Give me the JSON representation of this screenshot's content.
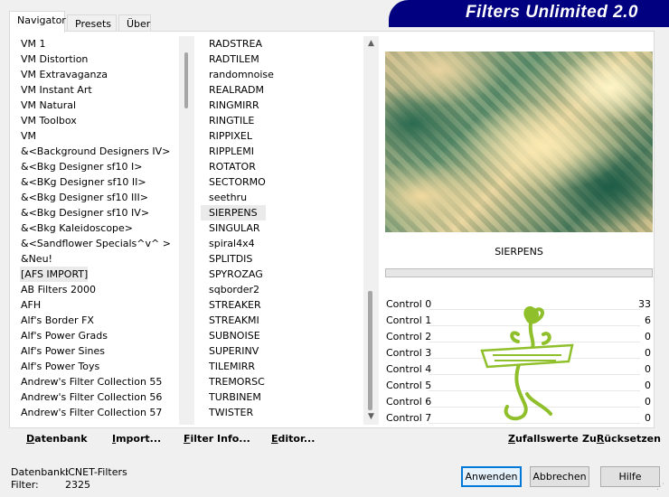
{
  "tabs": [
    {
      "label": "Navigator"
    },
    {
      "label": "Presets"
    },
    {
      "label": "Über"
    }
  ],
  "banner": {
    "title": "Filters Unlimited 2.0"
  },
  "categories": [
    "VM 1",
    "VM Distortion",
    "VM Extravaganza",
    "VM Instant Art",
    "VM Natural",
    "VM Toolbox",
    "VM",
    "&<Background Designers IV>",
    "&<Bkg Designer sf10 I>",
    "&<BKg Designer sf10 II>",
    "&<Bkg Designer sf10 III>",
    "&<Bkg Designer sf10 IV>",
    "&<Bkg Kaleidoscope>",
    "&<Sandflower Specials^v^ >",
    "&Neu!",
    "[AFS IMPORT]",
    "AB Filters 2000",
    "AFH",
    "Alf's Border FX",
    "Alf's Power Grads",
    "Alf's Power Sines",
    "Alf's Power Toys",
    "Andrew's Filter Collection 55",
    "Andrew's Filter Collection 56",
    "Andrew's Filter Collection 57"
  ],
  "selected_category": "[AFS IMPORT]",
  "filters": [
    "RADSTREA",
    "RADTILEM",
    "randomnoise",
    "REALRADM",
    "RINGMIRR",
    "RINGTILE",
    "RIPPIXEL",
    "RIPPLEMI",
    "ROTATOR",
    "SECTORMO",
    "seethru",
    "SIERPENS",
    "SINGULAR",
    "spiral4x4",
    "SPLITDIS",
    "SPYROZAG",
    "sqborder2",
    "STREAKER",
    "STREAKMI",
    "SUBNOISE",
    "SUPERINV",
    "TILEMIRR",
    "TREMORSC",
    "TURBINEM",
    "TWISTER"
  ],
  "selected_filter": "SIERPENS",
  "preview": {
    "label": "SIERPENS"
  },
  "controls": [
    {
      "label": "Control 0",
      "value": "33"
    },
    {
      "label": "Control 1",
      "value": "6"
    },
    {
      "label": "Control 2",
      "value": "0"
    },
    {
      "label": "Control 3",
      "value": "0"
    },
    {
      "label": "Control 4",
      "value": "0"
    },
    {
      "label": "Control 5",
      "value": "0"
    },
    {
      "label": "Control 6",
      "value": "0"
    },
    {
      "label": "Control 7",
      "value": "0"
    }
  ],
  "toolbar": {
    "datenbank": {
      "u": "D",
      "rest": "atenbank"
    },
    "import": {
      "u": "I",
      "rest": "mport..."
    },
    "filter_info": {
      "u": "F",
      "rest": "ilter Info..."
    },
    "editor": {
      "u": "E",
      "rest": "ditor..."
    },
    "random": {
      "u": "Z",
      "rest": "ufallswerte"
    },
    "reset": {
      "u": "R",
      "rest": "ücksetzen",
      "prefix": "Zu"
    }
  },
  "footer": {
    "db_label": "Datenbank:",
    "db_value": "ICNET-Filters",
    "filter_label": "Filter:",
    "filter_value": "2325",
    "apply": "Anwenden",
    "cancel": "Abbrechen",
    "help": "Hilfe"
  },
  "colors": {
    "banner": "#000080",
    "selection": "#eaeaea",
    "watermark": "#8fbf2a"
  }
}
